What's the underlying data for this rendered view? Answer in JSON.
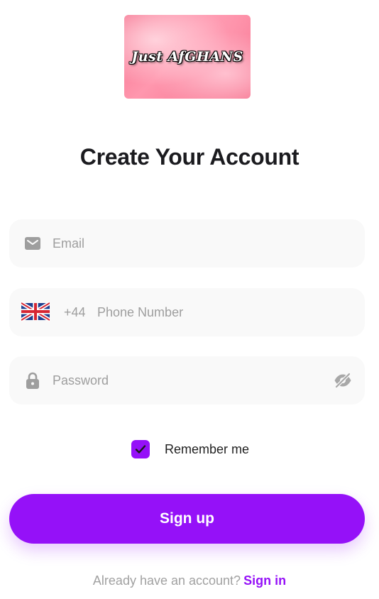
{
  "logo": {
    "text": "Just AfGHANS"
  },
  "title": "Create Your Account",
  "email": {
    "placeholder": "Email",
    "icon": "envelope-icon"
  },
  "phone": {
    "flag": "uk-flag-icon",
    "country_code": "+44",
    "placeholder": "Phone Number"
  },
  "password": {
    "placeholder": "Password",
    "icon": "lock-icon",
    "toggle_icon": "eye-off-icon"
  },
  "remember": {
    "label": "Remember me",
    "checked": true
  },
  "signup_button": {
    "label": "Sign up"
  },
  "footer": {
    "prompt": "Already have an account?",
    "link": "Sign in"
  },
  "colors": {
    "accent": "#9511f8",
    "field_bg": "#f9f9f9",
    "title": "#1b1b1f",
    "muted": "#9e9e9e"
  }
}
